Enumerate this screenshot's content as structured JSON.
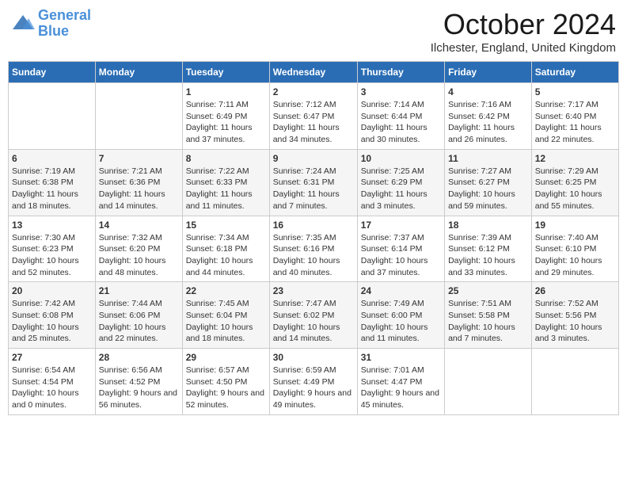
{
  "logo": {
    "line1": "General",
    "line2": "Blue"
  },
  "title": "October 2024",
  "location": "Ilchester, England, United Kingdom",
  "days_header": [
    "Sunday",
    "Monday",
    "Tuesday",
    "Wednesday",
    "Thursday",
    "Friday",
    "Saturday"
  ],
  "weeks": [
    [
      {
        "day": "",
        "content": ""
      },
      {
        "day": "",
        "content": ""
      },
      {
        "day": "1",
        "content": "Sunrise: 7:11 AM\nSunset: 6:49 PM\nDaylight: 11 hours and 37 minutes."
      },
      {
        "day": "2",
        "content": "Sunrise: 7:12 AM\nSunset: 6:47 PM\nDaylight: 11 hours and 34 minutes."
      },
      {
        "day": "3",
        "content": "Sunrise: 7:14 AM\nSunset: 6:44 PM\nDaylight: 11 hours and 30 minutes."
      },
      {
        "day": "4",
        "content": "Sunrise: 7:16 AM\nSunset: 6:42 PM\nDaylight: 11 hours and 26 minutes."
      },
      {
        "day": "5",
        "content": "Sunrise: 7:17 AM\nSunset: 6:40 PM\nDaylight: 11 hours and 22 minutes."
      }
    ],
    [
      {
        "day": "6",
        "content": "Sunrise: 7:19 AM\nSunset: 6:38 PM\nDaylight: 11 hours and 18 minutes."
      },
      {
        "day": "7",
        "content": "Sunrise: 7:21 AM\nSunset: 6:36 PM\nDaylight: 11 hours and 14 minutes."
      },
      {
        "day": "8",
        "content": "Sunrise: 7:22 AM\nSunset: 6:33 PM\nDaylight: 11 hours and 11 minutes."
      },
      {
        "day": "9",
        "content": "Sunrise: 7:24 AM\nSunset: 6:31 PM\nDaylight: 11 hours and 7 minutes."
      },
      {
        "day": "10",
        "content": "Sunrise: 7:25 AM\nSunset: 6:29 PM\nDaylight: 11 hours and 3 minutes."
      },
      {
        "day": "11",
        "content": "Sunrise: 7:27 AM\nSunset: 6:27 PM\nDaylight: 10 hours and 59 minutes."
      },
      {
        "day": "12",
        "content": "Sunrise: 7:29 AM\nSunset: 6:25 PM\nDaylight: 10 hours and 55 minutes."
      }
    ],
    [
      {
        "day": "13",
        "content": "Sunrise: 7:30 AM\nSunset: 6:23 PM\nDaylight: 10 hours and 52 minutes."
      },
      {
        "day": "14",
        "content": "Sunrise: 7:32 AM\nSunset: 6:20 PM\nDaylight: 10 hours and 48 minutes."
      },
      {
        "day": "15",
        "content": "Sunrise: 7:34 AM\nSunset: 6:18 PM\nDaylight: 10 hours and 44 minutes."
      },
      {
        "day": "16",
        "content": "Sunrise: 7:35 AM\nSunset: 6:16 PM\nDaylight: 10 hours and 40 minutes."
      },
      {
        "day": "17",
        "content": "Sunrise: 7:37 AM\nSunset: 6:14 PM\nDaylight: 10 hours and 37 minutes."
      },
      {
        "day": "18",
        "content": "Sunrise: 7:39 AM\nSunset: 6:12 PM\nDaylight: 10 hours and 33 minutes."
      },
      {
        "day": "19",
        "content": "Sunrise: 7:40 AM\nSunset: 6:10 PM\nDaylight: 10 hours and 29 minutes."
      }
    ],
    [
      {
        "day": "20",
        "content": "Sunrise: 7:42 AM\nSunset: 6:08 PM\nDaylight: 10 hours and 25 minutes."
      },
      {
        "day": "21",
        "content": "Sunrise: 7:44 AM\nSunset: 6:06 PM\nDaylight: 10 hours and 22 minutes."
      },
      {
        "day": "22",
        "content": "Sunrise: 7:45 AM\nSunset: 6:04 PM\nDaylight: 10 hours and 18 minutes."
      },
      {
        "day": "23",
        "content": "Sunrise: 7:47 AM\nSunset: 6:02 PM\nDaylight: 10 hours and 14 minutes."
      },
      {
        "day": "24",
        "content": "Sunrise: 7:49 AM\nSunset: 6:00 PM\nDaylight: 10 hours and 11 minutes."
      },
      {
        "day": "25",
        "content": "Sunrise: 7:51 AM\nSunset: 5:58 PM\nDaylight: 10 hours and 7 minutes."
      },
      {
        "day": "26",
        "content": "Sunrise: 7:52 AM\nSunset: 5:56 PM\nDaylight: 10 hours and 3 minutes."
      }
    ],
    [
      {
        "day": "27",
        "content": "Sunrise: 6:54 AM\nSunset: 4:54 PM\nDaylight: 10 hours and 0 minutes."
      },
      {
        "day": "28",
        "content": "Sunrise: 6:56 AM\nSunset: 4:52 PM\nDaylight: 9 hours and 56 minutes."
      },
      {
        "day": "29",
        "content": "Sunrise: 6:57 AM\nSunset: 4:50 PM\nDaylight: 9 hours and 52 minutes."
      },
      {
        "day": "30",
        "content": "Sunrise: 6:59 AM\nSunset: 4:49 PM\nDaylight: 9 hours and 49 minutes."
      },
      {
        "day": "31",
        "content": "Sunrise: 7:01 AM\nSunset: 4:47 PM\nDaylight: 9 hours and 45 minutes."
      },
      {
        "day": "",
        "content": ""
      },
      {
        "day": "",
        "content": ""
      }
    ]
  ]
}
